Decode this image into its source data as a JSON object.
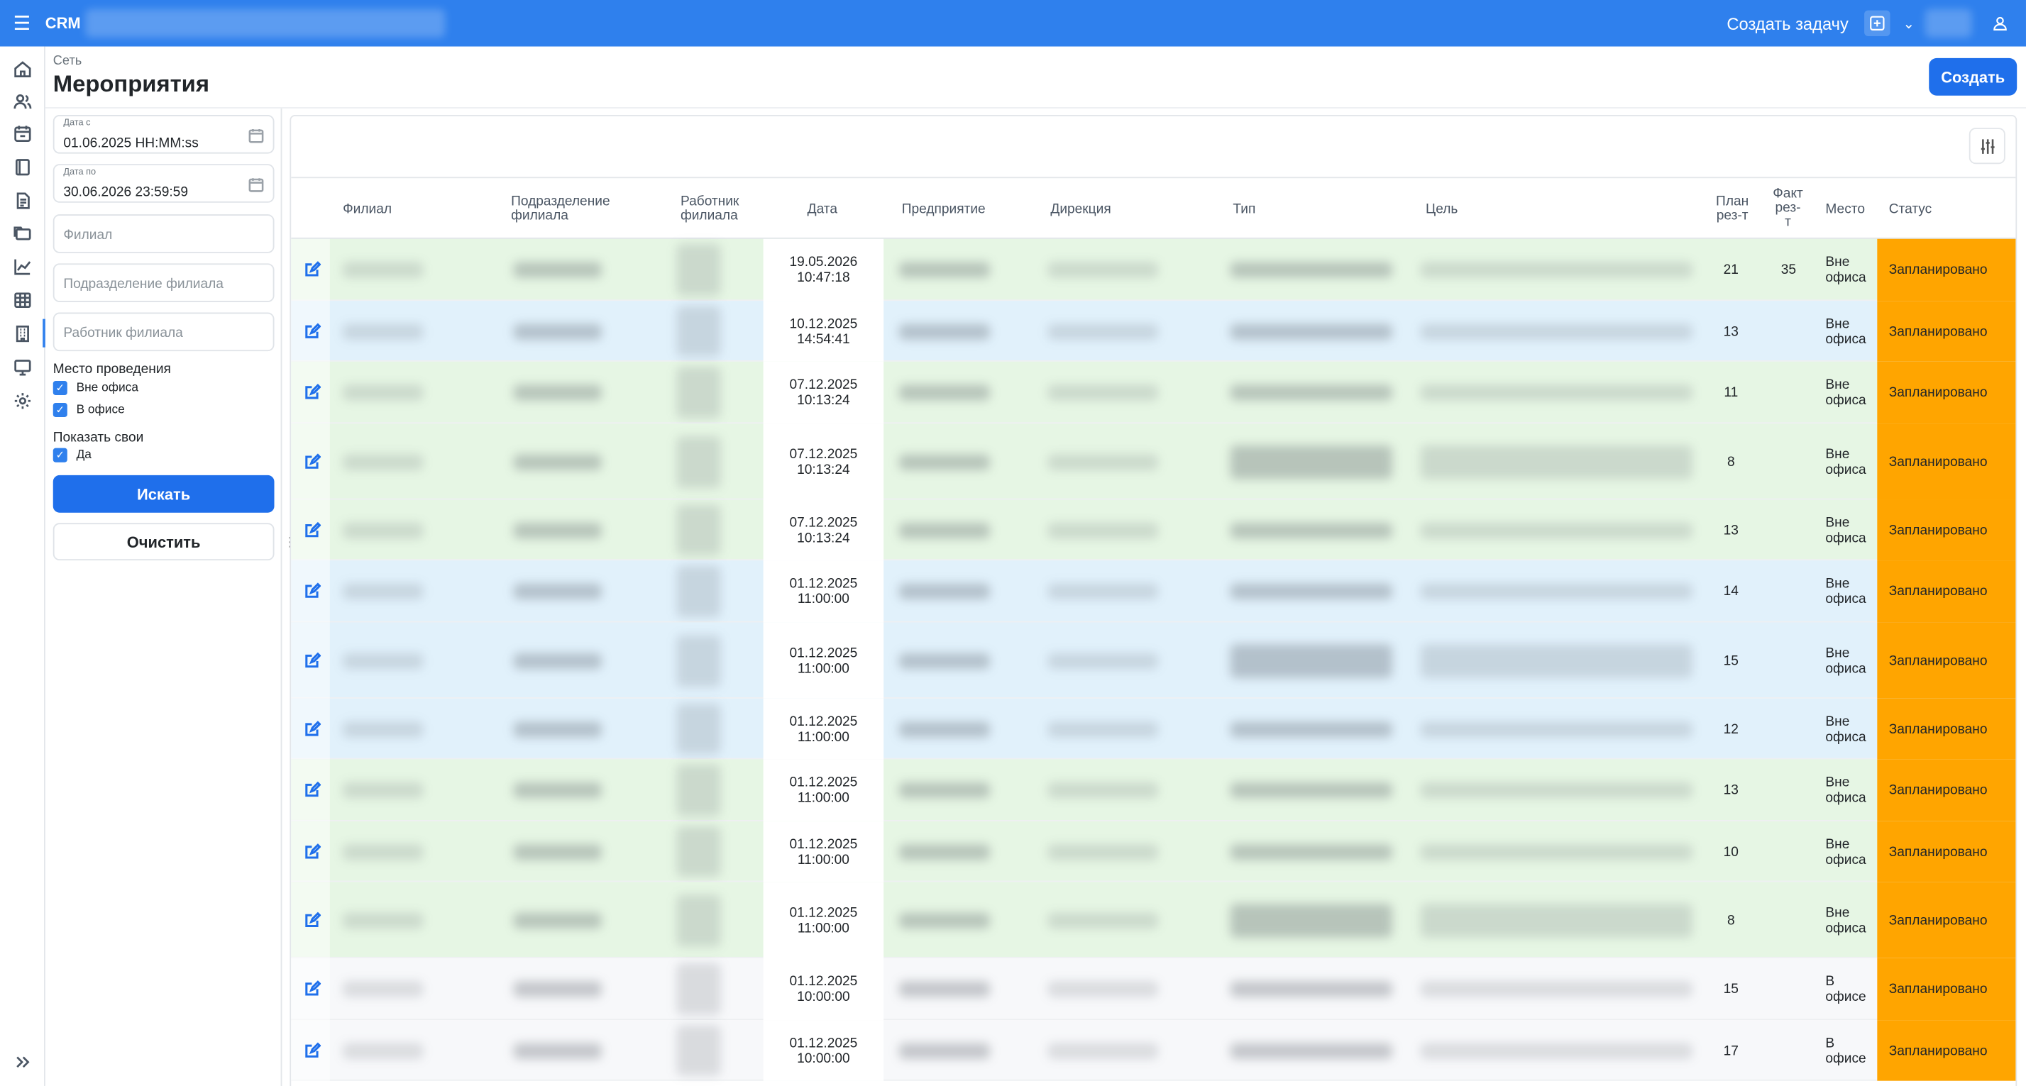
{
  "topbar": {
    "brand": "CRM",
    "create_task": "Создать задачу",
    "menu_icon": "hamburger-icon",
    "add_icon": "plus-square-icon",
    "user_icon": "user-icon"
  },
  "sidebar": {
    "icons": [
      "home-icon",
      "users-icon",
      "calendar-icon",
      "book-icon",
      "document-icon",
      "folders-icon",
      "chart-line-icon",
      "table-icon",
      "building-icon",
      "monitor-icon",
      "gear-icon"
    ],
    "expand_icon": "double-chevron-right-icon"
  },
  "header": {
    "breadcrumb": "Сеть",
    "title": "Мероприятия",
    "create_label": "Создать"
  },
  "filters": {
    "date_from_label": "Дата с",
    "date_from_value": "01.06.2025 HH:MM:ss",
    "date_to_label": "Дата по",
    "date_to_value": "30.06.2026 23:59:59",
    "branch_placeholder": "Филиал",
    "subdivision_placeholder": "Подразделение филиала",
    "employee_placeholder": "Работник филиала",
    "place_title": "Место проведения",
    "place_out": "Вне офиса",
    "place_in": "В офисе",
    "own_title": "Показать свои",
    "own_yes": "Да",
    "search_label": "Искать",
    "clear_label": "Очистить"
  },
  "table": {
    "columns": {
      "branch": "Филиал",
      "subdivision_1": "Подразделение",
      "subdivision_2": "филиала",
      "employee_1": "Работник",
      "employee_2": "филиала",
      "date": "Дата",
      "enterprise": "Предприятие",
      "directorate": "Дирекция",
      "type": "Тип",
      "goal": "Цель",
      "plan_1": "План",
      "plan_2": "рез-т",
      "fact_1": "Факт",
      "fact_2": "рез-",
      "fact_3": "т",
      "place": "Место",
      "status": "Статус"
    },
    "rows": [
      {
        "date": "19.05.2026",
        "time": "10:47:18",
        "plan": "21",
        "fact": "35",
        "place_1": "Вне",
        "place_2": "офиса",
        "status": "Запланировано"
      },
      {
        "date": "10.12.2025",
        "time": "14:54:41",
        "plan": "13",
        "fact": "",
        "place_1": "Вне",
        "place_2": "офиса",
        "status": "Запланировано"
      },
      {
        "date": "07.12.2025",
        "time": "10:13:24",
        "plan": "11",
        "fact": "",
        "place_1": "Вне",
        "place_2": "офиса",
        "status": "Запланировано"
      },
      {
        "date": "07.12.2025",
        "time": "10:13:24",
        "plan": "8",
        "fact": "",
        "place_1": "Вне",
        "place_2": "офиса",
        "status": "Запланировано"
      },
      {
        "date": "07.12.2025",
        "time": "10:13:24",
        "plan": "13",
        "fact": "",
        "place_1": "Вне",
        "place_2": "офиса",
        "status": "Запланировано"
      },
      {
        "date": "01.12.2025",
        "time": "11:00:00",
        "plan": "14",
        "fact": "",
        "place_1": "Вне",
        "place_2": "офиса",
        "status": "Запланировано"
      },
      {
        "date": "01.12.2025",
        "time": "11:00:00",
        "plan": "15",
        "fact": "",
        "place_1": "Вне",
        "place_2": "офиса",
        "status": "Запланировано"
      },
      {
        "date": "01.12.2025",
        "time": "11:00:00",
        "plan": "12",
        "fact": "",
        "place_1": "Вне",
        "place_2": "офиса",
        "status": "Запланировано"
      },
      {
        "date": "01.12.2025",
        "time": "11:00:00",
        "plan": "13",
        "fact": "",
        "place_1": "Вне",
        "place_2": "офиса",
        "status": "Запланировано"
      },
      {
        "date": "01.12.2025",
        "time": "11:00:00",
        "plan": "10",
        "fact": "",
        "place_1": "Вне",
        "place_2": "офиса",
        "status": "Запланировано"
      },
      {
        "date": "01.12.2025",
        "time": "11:00:00",
        "plan": "8",
        "fact": "",
        "place_1": "Вне",
        "place_2": "офиса",
        "status": "Запланировано"
      },
      {
        "date": "01.12.2025",
        "time": "10:00:00",
        "plan": "15",
        "fact": "",
        "place_1": "В",
        "place_2": "офисе",
        "status": "Запланировано"
      },
      {
        "date": "01.12.2025",
        "time": "10:00:00",
        "plan": "17",
        "fact": "",
        "place_1": "В",
        "place_2": "офисе",
        "status": "Запланировано"
      }
    ]
  },
  "colors": {
    "primary": "#1f6feb",
    "topbar": "#2f80ed",
    "status_planned": "#ffa500",
    "row_green": "#e6f6e4",
    "row_blue": "#e1f1fb"
  }
}
